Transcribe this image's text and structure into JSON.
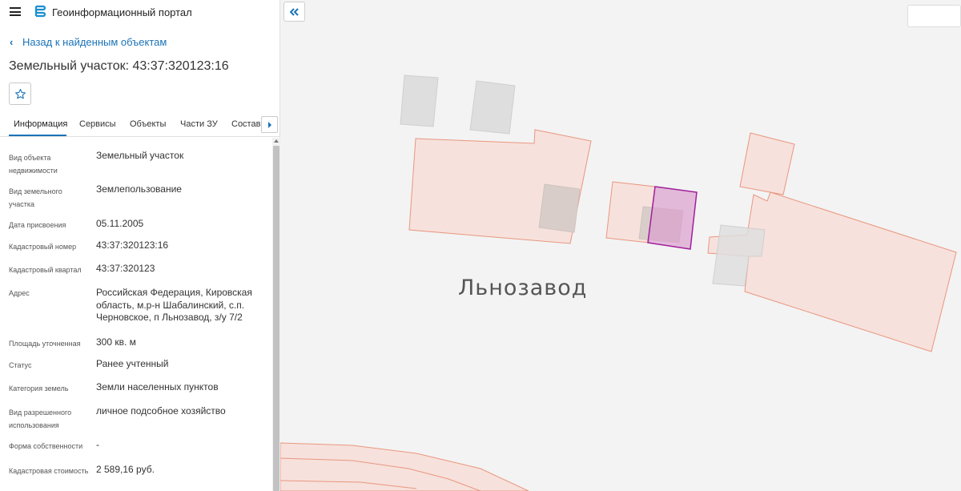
{
  "header": {
    "app_title": "Геоинформационный портал",
    "menu_icon": "hamburger-menu-icon",
    "logo_icon": "portal-logo-icon"
  },
  "nav": {
    "back_label": "Назад к найденным объектам"
  },
  "page": {
    "title": "Земельный участок: 43:37:320123:16"
  },
  "tabs": [
    {
      "label": "Информация",
      "active": true
    },
    {
      "label": "Сервисы"
    },
    {
      "label": "Объекты"
    },
    {
      "label": "Части ЗУ"
    },
    {
      "label": "Состав"
    }
  ],
  "properties": [
    {
      "label": "Вид объекта недвижимости",
      "value": "Земельный участок"
    },
    {
      "label": "Вид земельного участка",
      "value": "Землепользование"
    },
    {
      "label": "Дата присвоения",
      "value": "05.11.2005"
    },
    {
      "label": "Кадастровый номер",
      "value": "43:37:320123:16"
    },
    {
      "label": "Кадастровый квартал",
      "value": "43:37:320123"
    },
    {
      "label": "Адрес",
      "value": "Российская Федерация, Кировская область, м.р-н Шабалинский, с.п. Черновское, п Льнозавод, з/у 7/2"
    },
    {
      "label": "Площадь уточненная",
      "value": "300 кв. м"
    },
    {
      "label": "Статус",
      "value": "Ранее учтенный"
    },
    {
      "label": "Категория земель",
      "value": "Земли населенных пунктов"
    },
    {
      "label": "Вид разрешенного использования",
      "value": "личное подсобное хозяйство"
    },
    {
      "label": "Форма собственности",
      "value": "-"
    },
    {
      "label": "Кадастровая стоимость",
      "value": "2 589,16 руб."
    }
  ],
  "map": {
    "place_label": "Льнозавод"
  },
  "colors": {
    "accent": "#1a73b8",
    "parcel_fill": "#f6dcd6",
    "parcel_stroke": "#e8977f",
    "selected_fill": "#d98fc7",
    "selected_stroke": "#a0209a",
    "building": "#dddddd"
  }
}
